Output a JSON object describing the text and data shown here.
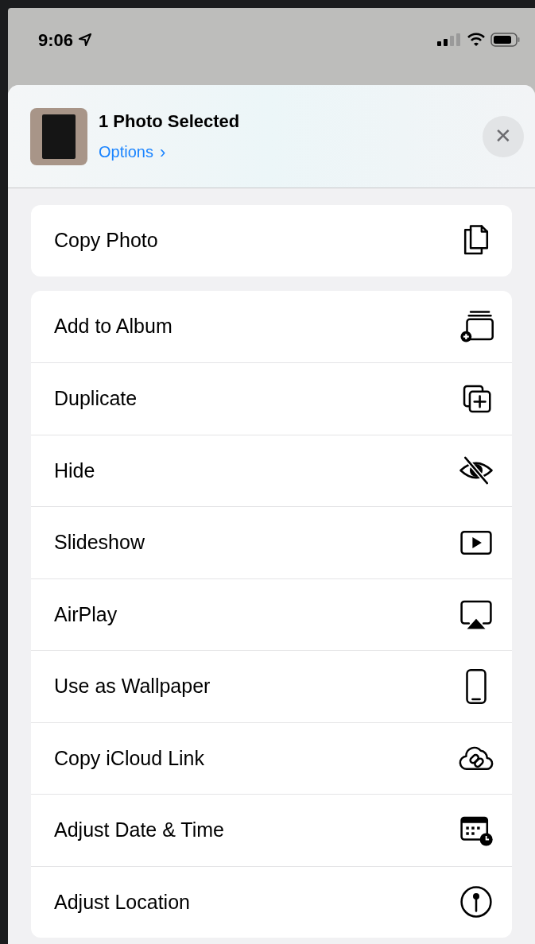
{
  "status_bar": {
    "time": "9:06"
  },
  "header": {
    "title": "1 Photo Selected",
    "options_link": "Options",
    "options_chevron": "›",
    "close_glyph": "✕"
  },
  "groups": [
    {
      "actions": [
        {
          "label": "Copy Photo",
          "kind": "copy"
        }
      ]
    },
    {
      "actions": [
        {
          "label": "Add to Album",
          "kind": "album"
        },
        {
          "label": "Duplicate",
          "kind": "duplicate"
        },
        {
          "label": "Hide",
          "kind": "hide"
        },
        {
          "label": "Slideshow",
          "kind": "slideshow"
        },
        {
          "label": "AirPlay",
          "kind": "airplay"
        },
        {
          "label": "Use as Wallpaper",
          "kind": "wallpaper"
        },
        {
          "label": "Copy iCloud Link",
          "kind": "cloudlink"
        },
        {
          "label": "Adjust Date & Time",
          "kind": "datetime"
        },
        {
          "label": "Adjust Location",
          "kind": "location"
        }
      ]
    }
  ]
}
